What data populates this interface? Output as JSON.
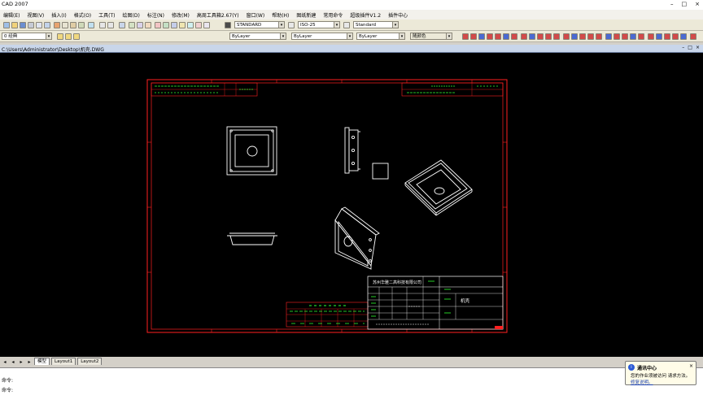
{
  "window": {
    "title": "CAD 2007",
    "controls": [
      "–",
      "□",
      "×"
    ]
  },
  "menu": [
    "编辑(E)",
    "视图(V)",
    "插入(I)",
    "格式(O)",
    "工具(T)",
    "绘图(D)",
    "标注(N)",
    "修改(M)",
    "高周工具箱2.67(Y)",
    "窗口(W)",
    "帮助(H)",
    "图纸新建",
    "常用命令",
    "超级插件V1.2",
    "插件中心"
  ],
  "layer_combo": {
    "value": "0 经典"
  },
  "style_combos": {
    "text_style": "STANDARD",
    "dim_style": "ISO-25",
    "table_style": "Standard"
  },
  "property_combos": {
    "layer": "ByLayer",
    "linetype": "ByLayer",
    "lineweight": "ByLayer",
    "plotstyle": "随颜色"
  },
  "drawing_path": "C:\\Users\\Administrator\\Desktop\\机壳.DWG",
  "drawing_controls": [
    "–",
    "□",
    "×"
  ],
  "tabs": {
    "model": "模型",
    "layout1": "Layout1",
    "layout2": "Layout2"
  },
  "command": {
    "line1": "命令:",
    "line2": "命令:"
  },
  "notification": {
    "title": "通讯中心",
    "line1": "您的作业须被访问 请求方法。",
    "line2_link": "修复说明。",
    "close": "×"
  },
  "title_block": {
    "company": "苏州华雅二高科技有限公司",
    "part_name": "机壳"
  },
  "colors": {
    "canvas": "#000000",
    "frame": "#ff2020",
    "geometry": "#ffffff",
    "annotation": "#30ff30"
  }
}
